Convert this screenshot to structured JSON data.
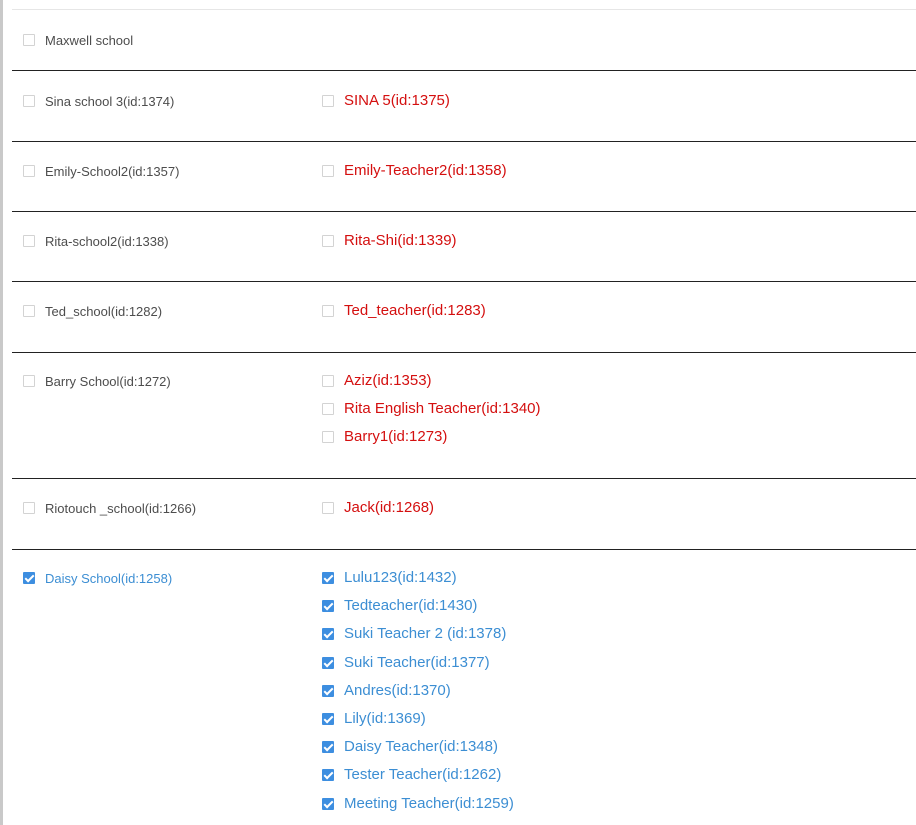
{
  "rows": [
    {
      "school": {
        "label": "Maxwell school",
        "checked": false
      },
      "teachers": []
    },
    {
      "school": {
        "label": "Sina school 3(id:1374)",
        "checked": false
      },
      "teachers": [
        {
          "label": "SINA 5(id:1375)",
          "checked": false
        }
      ]
    },
    {
      "school": {
        "label": "Emily-School2(id:1357)",
        "checked": false
      },
      "teachers": [
        {
          "label": "Emily-Teacher2(id:1358)",
          "checked": false
        }
      ]
    },
    {
      "school": {
        "label": "Rita-school2(id:1338)",
        "checked": false
      },
      "teachers": [
        {
          "label": "Rita-Shi(id:1339)",
          "checked": false
        }
      ]
    },
    {
      "school": {
        "label": "Ted_school(id:1282)",
        "checked": false
      },
      "teachers": [
        {
          "label": "Ted_teacher(id:1283)",
          "checked": false
        }
      ]
    },
    {
      "school": {
        "label": "Barry School(id:1272)",
        "checked": false
      },
      "teachers": [
        {
          "label": "Aziz(id:1353)",
          "checked": false
        },
        {
          "label": "Rita English Teacher(id:1340)",
          "checked": false
        },
        {
          "label": "Barry1(id:1273)",
          "checked": false
        }
      ]
    },
    {
      "school": {
        "label": "Riotouch _school(id:1266)",
        "checked": false
      },
      "teachers": [
        {
          "label": "Jack(id:1268)",
          "checked": false
        }
      ]
    },
    {
      "school": {
        "label": "Daisy School(id:1258)",
        "checked": true
      },
      "teachers": [
        {
          "label": "Lulu123(id:1432)",
          "checked": true
        },
        {
          "label": "Tedteacher(id:1430)",
          "checked": true
        },
        {
          "label": "Suki Teacher 2 (id:1378)",
          "checked": true
        },
        {
          "label": "Suki Teacher(id:1377)",
          "checked": true
        },
        {
          "label": "Andres(id:1370)",
          "checked": true
        },
        {
          "label": "Lily(id:1369)",
          "checked": true
        },
        {
          "label": "Daisy Teacher(id:1348)",
          "checked": true
        },
        {
          "label": "Tester Teacher(id:1262)",
          "checked": true
        },
        {
          "label": "Meeting Teacher(id:1259)",
          "checked": true
        }
      ]
    }
  ],
  "colors": {
    "school_text": "#4d4d4d",
    "teacher_text": "#d40f0f",
    "checked_text": "#3c8ed3",
    "checkbox_checked": "#3d8ee0",
    "row_divider": "#222222"
  }
}
